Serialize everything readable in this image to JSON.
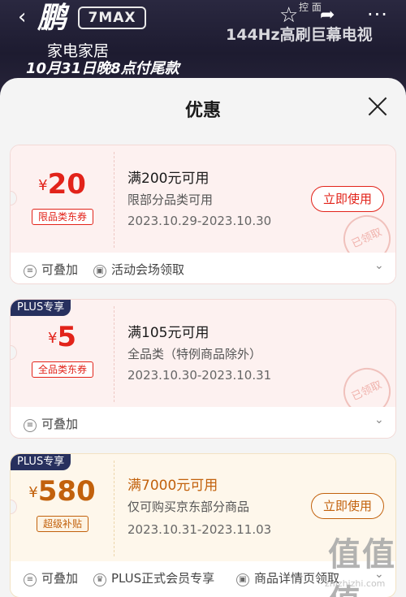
{
  "banner": {
    "back_icon": "chevron-left-icon",
    "logo_text": "鹏",
    "model_text": "7MAX",
    "promo_line1": "家电家居",
    "promo_line2": "10月31日晚8点付尾款",
    "tv_text": "144Hz高刷巨幕电视",
    "actions_hint": "控 面",
    "icons": [
      "star-icon",
      "share-icon",
      "more-icon"
    ]
  },
  "sheet": {
    "title": "优惠",
    "close_icon": "close-icon"
  },
  "coupons": [
    {
      "currency": "¥",
      "amount": "20",
      "tag": "限品类东券",
      "condition": "满200元可用",
      "scope": "限部分品类可用",
      "dates": "2023.10.29-2023.10.30",
      "button": "立即使用",
      "stamp": "已领取",
      "footer": [
        "可叠加",
        "活动会场领取"
      ]
    },
    {
      "badge": "PLUS专享",
      "currency": "¥",
      "amount": "5",
      "tag": "全品类东券",
      "condition": "满105元可用",
      "scope": "全品类（特例商品除外）",
      "dates": "2023.10.30-2023.10.31",
      "stamp": "已领取",
      "footer": [
        "可叠加"
      ]
    },
    {
      "badge": "PLUS专享",
      "currency": "¥",
      "amount": "580",
      "tag": "超级补贴",
      "condition": "满7000元可用",
      "scope": "仅可购买京东部分商品",
      "dates": "2023.10.31-2023.11.03",
      "button": "立即使用",
      "footer": [
        "可叠加",
        "PLUS正式会员专享",
        "商品详情页领取"
      ]
    }
  ],
  "colors": {
    "accent_red": "#e2231a",
    "accent_gold": "#c2610c",
    "plus_badge": "#27305e"
  },
  "watermark": {
    "text": "值值值",
    "url": "zhizhizhi.com"
  }
}
